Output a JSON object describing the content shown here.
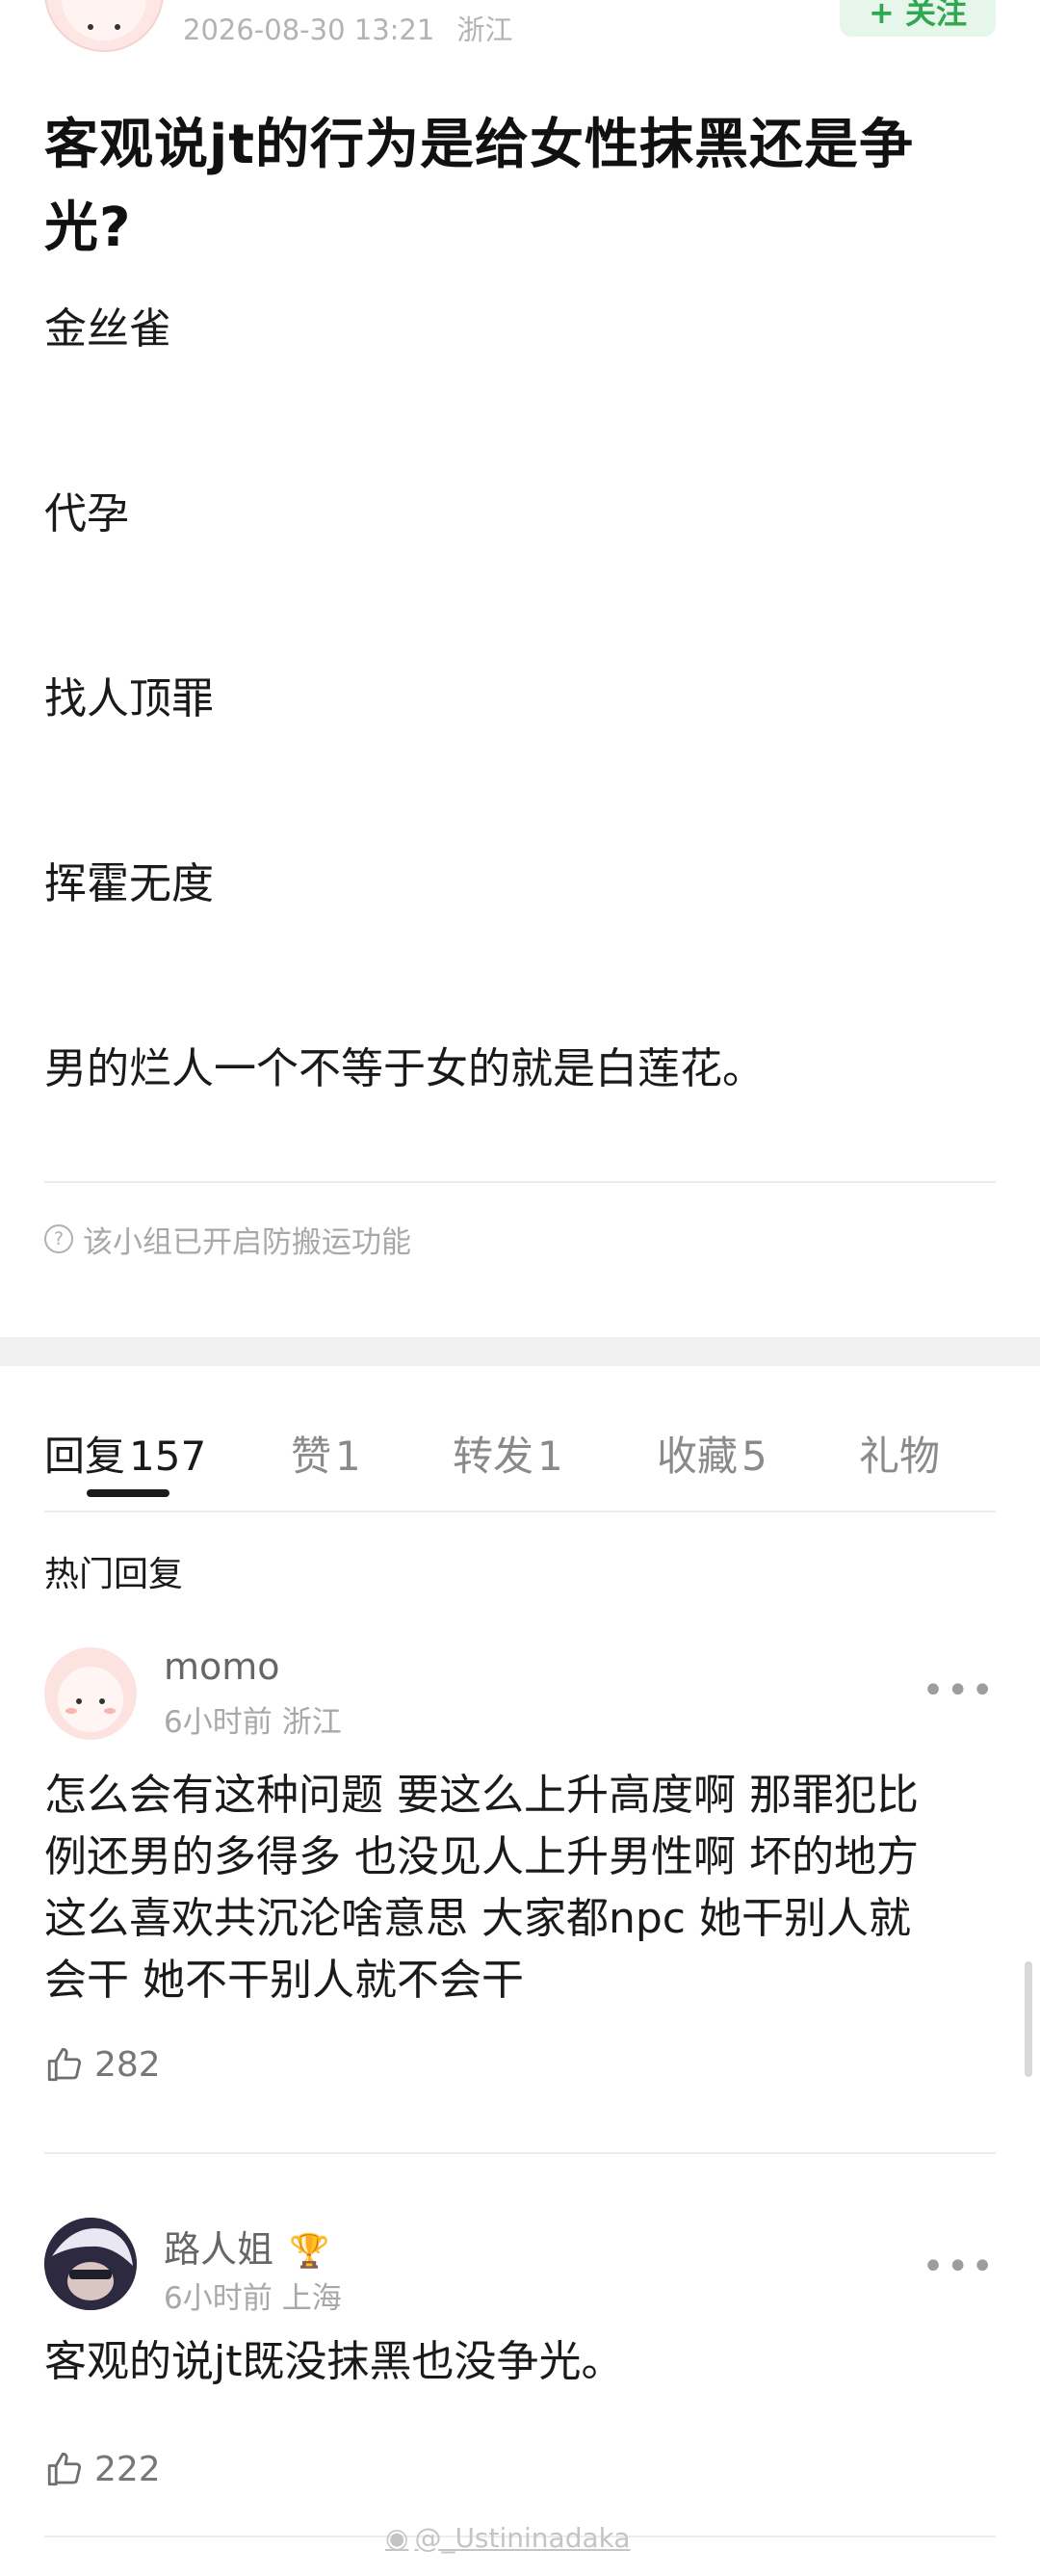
{
  "post": {
    "timestamp": "2026-08-30 13:21",
    "location": "浙江",
    "follow_label": "+ 关注",
    "title": "客观说jt的行为是给女性抹黑还是争光?",
    "body_lines": [
      "金丝雀",
      "代孕",
      "找人顶罪",
      "挥霍无度",
      "男的烂人一个不等于女的就是白莲花。"
    ],
    "notice": "该小组已开启防搬运功能"
  },
  "tabs": [
    {
      "label": "回复",
      "count": "157"
    },
    {
      "label": "赞",
      "count": "1"
    },
    {
      "label": "转发",
      "count": "1"
    },
    {
      "label": "收藏",
      "count": "5"
    },
    {
      "label": "礼物",
      "count": ""
    }
  ],
  "hot_label": "热门回复",
  "comments": [
    {
      "name": "momo",
      "time": "6小时前",
      "location": "浙江",
      "lines": [
        "怎么会有这种问题 要这么上升高度啊 那罪犯比",
        "例还男的多得多 也没见人上升男性啊 坏的地方",
        "这么喜欢共沉沦啥意思 大家都npc 她干别人就",
        "会干 她不干别人就不会干"
      ],
      "likes": "282"
    },
    {
      "name": "路人姐",
      "badge_icon": "trophy-icon",
      "time": "6小时前",
      "location": "上海",
      "lines": [
        "客观的说jt既没抹黑也没争光。"
      ],
      "likes": "222"
    }
  ],
  "more_label": "•••",
  "watermark": "@_Ustininadaka"
}
